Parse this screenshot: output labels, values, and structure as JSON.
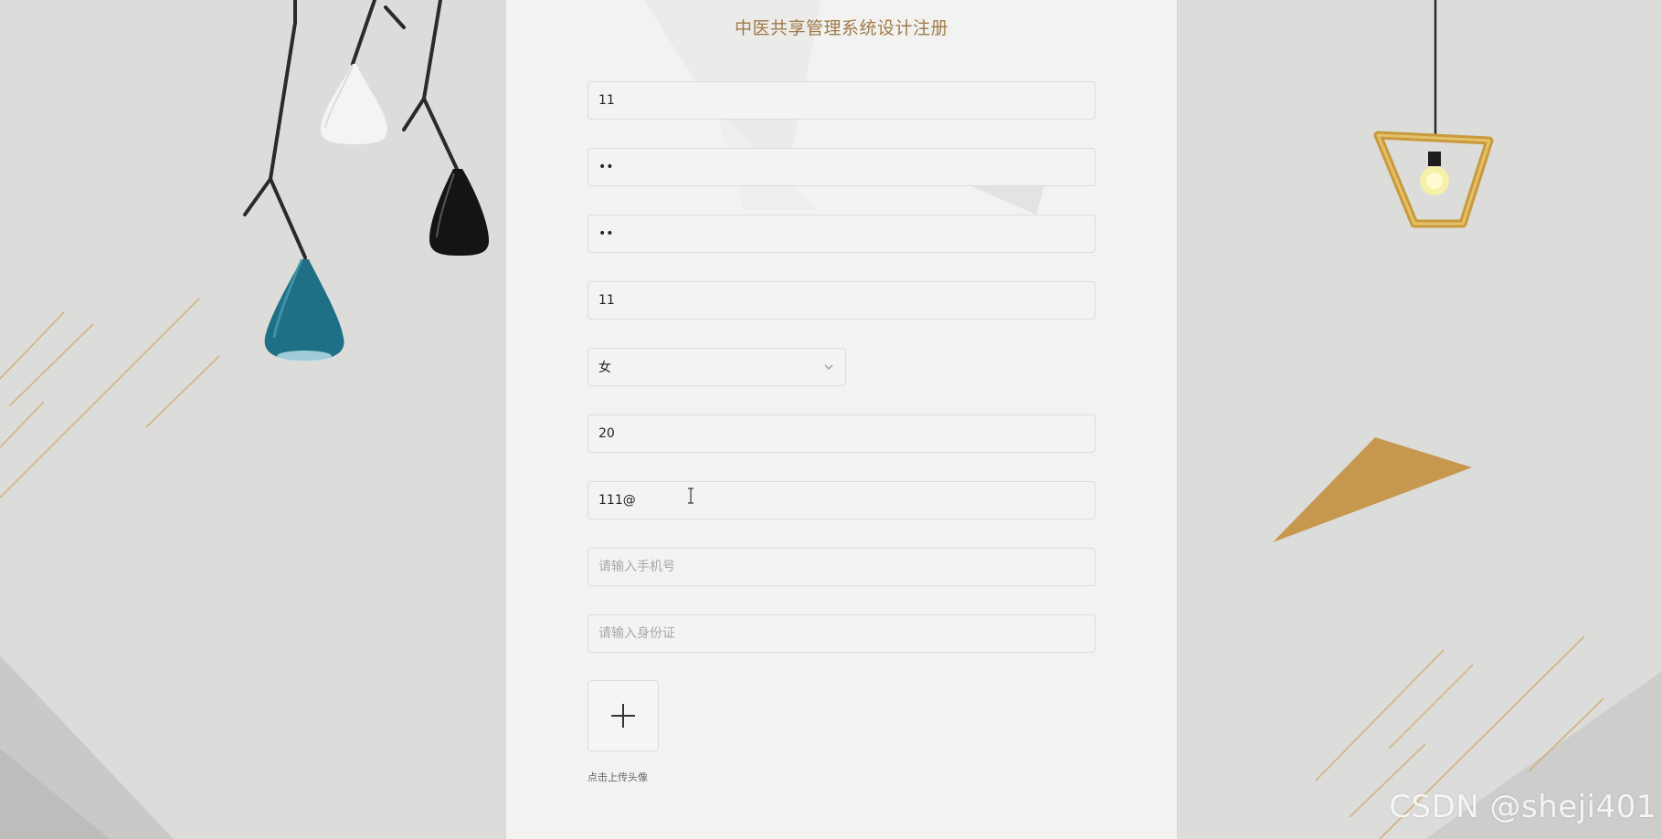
{
  "form": {
    "title": "中医共享管理系统设计注册",
    "fields": [
      {
        "value": "11",
        "placeholder": ""
      },
      {
        "value": "••",
        "placeholder": ""
      },
      {
        "value": "••",
        "placeholder": ""
      },
      {
        "value": "11",
        "placeholder": ""
      }
    ],
    "gender": {
      "selected": "女"
    },
    "age": {
      "value": "20",
      "placeholder": ""
    },
    "email": {
      "value": "111@",
      "placeholder": ""
    },
    "phone": {
      "value": "",
      "placeholder": "请输入手机号"
    },
    "id_card": {
      "value": "",
      "placeholder": "请输入身份证"
    },
    "upload": {
      "hint": "点击上传头像",
      "icon": "plus-icon"
    }
  },
  "watermark": "CSDN @sheji401",
  "colors": {
    "title": "#a07a48",
    "accent_gold": "#c69a52",
    "lamp_teal": "#1f6f86"
  }
}
